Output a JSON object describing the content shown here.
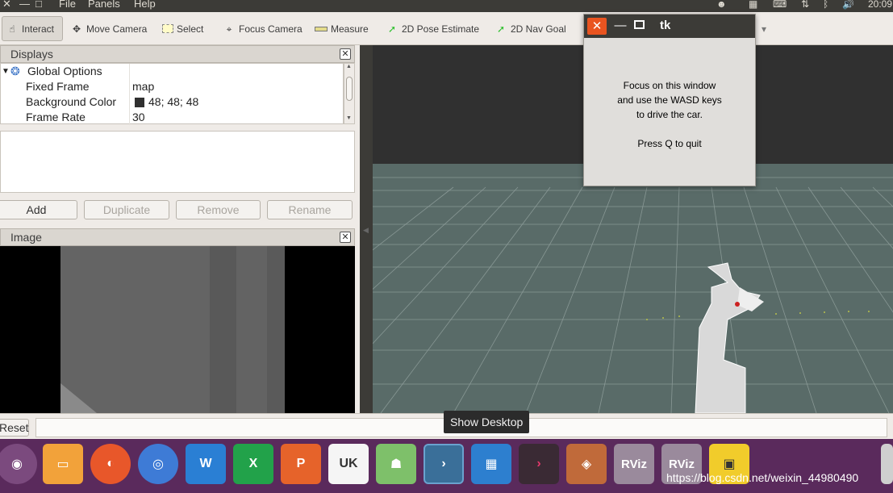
{
  "topbar": {
    "menu": [
      "File",
      "Panels",
      "Help"
    ],
    "clock": "20:09"
  },
  "toolbar": {
    "tools": [
      {
        "label": "Interact",
        "icon": "hand-pointer-icon",
        "active": true
      },
      {
        "label": "Move Camera",
        "icon": "move-camera-icon",
        "active": false
      },
      {
        "label": "Select",
        "icon": "select-box-icon",
        "active": false
      },
      {
        "label": "Focus Camera",
        "icon": "focus-camera-icon",
        "active": false
      },
      {
        "label": "Measure",
        "icon": "ruler-icon",
        "active": false
      },
      {
        "label": "2D Pose Estimate",
        "icon": "green-arrow-icon",
        "active": false
      },
      {
        "label": "2D Nav Goal",
        "icon": "green-arrow-icon",
        "active": false
      }
    ]
  },
  "displays": {
    "title": "Displays",
    "global_options": "Global Options",
    "properties": [
      {
        "key": "Fixed Frame",
        "value": "map"
      },
      {
        "key": "Background Color",
        "value": "48; 48; 48",
        "swatch": "#303030"
      },
      {
        "key": "Frame Rate",
        "value": "30"
      }
    ],
    "buttons": {
      "add": "Add",
      "duplicate": "Duplicate",
      "remove": "Remove",
      "rename": "Rename"
    }
  },
  "image_panel": {
    "title": "Image"
  },
  "tk_window": {
    "title": "tk",
    "message_lines": [
      "Focus on this window",
      "and use the WASD keys",
      "to drive the car.",
      "",
      "Press Q to quit"
    ]
  },
  "statusbar": {
    "reset": "Reset"
  },
  "tooltip": "Show Desktop",
  "dock": {
    "items": [
      {
        "name": "ubuntu-logo-icon",
        "color": "#7b4a7e"
      },
      {
        "name": "files-folder-icon",
        "color": "#f2a23a"
      },
      {
        "name": "firefox-icon",
        "color": "#e8572a"
      },
      {
        "name": "chromium-icon",
        "color": "#3e7bd6"
      },
      {
        "name": "wps-writer-icon",
        "color": "#2a7fd4",
        "text": "W"
      },
      {
        "name": "wps-spreadsheet-icon",
        "color": "#22a24a",
        "text": "X"
      },
      {
        "name": "wps-presentation-icon",
        "color": "#e6632a",
        "text": "P"
      },
      {
        "name": "ubuntu-software-icon",
        "color": "#f5f5f5"
      },
      {
        "name": "ros-robot-icon",
        "color": "#7ec06a"
      },
      {
        "name": "terminal-icon",
        "color": "#3a6f99",
        "text": "›"
      },
      {
        "name": "workspace-switcher-icon",
        "color": "#2d7fcf"
      },
      {
        "name": "terminal-red-icon",
        "color": "#3a2a34",
        "text": "›"
      },
      {
        "name": "gazebo-icon",
        "color": "#c06a3a"
      },
      {
        "name": "rviz-icon",
        "color": "#9a8a9c",
        "text": "RViz"
      },
      {
        "name": "rviz-icon-2",
        "color": "#9a8a9c",
        "text": "RViz"
      },
      {
        "name": "save-floppy-icon",
        "color": "#f1cc2b"
      }
    ]
  },
  "watermark": "https://blog.csdn.net/weixin_44980490"
}
